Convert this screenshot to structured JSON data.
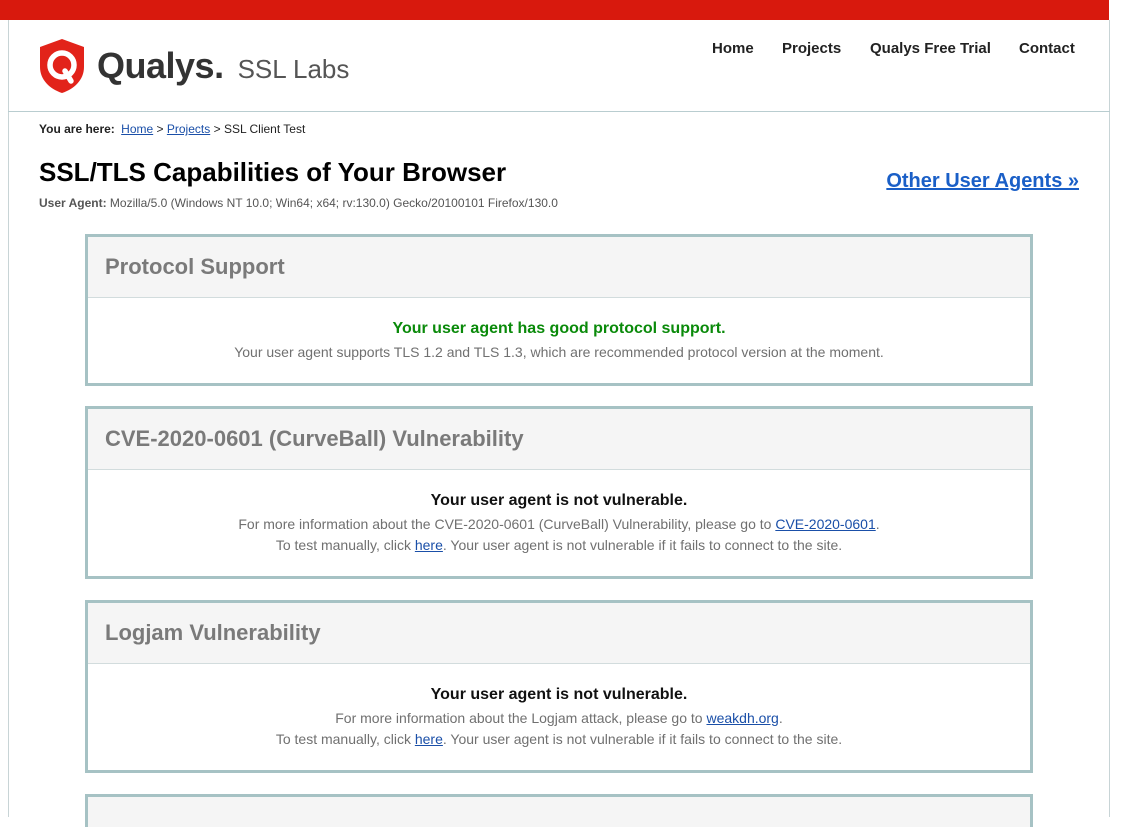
{
  "brand": {
    "name": "Qualys",
    "dot": ".",
    "product": "SSL Labs",
    "shield_color": "#e2231a"
  },
  "nav": {
    "home": "Home",
    "projects": "Projects",
    "trial": "Qualys Free Trial",
    "contact": "Contact"
  },
  "breadcrumb": {
    "prefix": "You are here:",
    "home": "Home",
    "sep1": ">",
    "projects": "Projects",
    "sep2": ">",
    "current": "SSL Client Test"
  },
  "page": {
    "title": "SSL/TLS Capabilities of Your Browser",
    "ua_label": "User Agent:",
    "ua_value": "Mozilla/5.0 (Windows NT 10.0; Win64; x64; rv:130.0) Gecko/20100101 Firefox/130.0",
    "other_ua_link": "Other User Agents »"
  },
  "sections": {
    "protocol": {
      "title": "Protocol Support",
      "verdict": "Your user agent has good protocol support.",
      "detail": "Your user agent supports TLS 1.2 and TLS 1.3, which are recommended protocol version at the moment."
    },
    "curveball": {
      "title": "CVE-2020-0601 (CurveBall) Vulnerability",
      "verdict": "Your user agent is not vulnerable.",
      "info_prefix": "For more information about the CVE-2020-0601 (CurveBall) Vulnerability, please go to",
      "info_link": "CVE-2020-0601",
      "info_suffix": ".",
      "test_prefix": "To test manually, click",
      "test_link": "here",
      "test_suffix": ". Your user agent is not vulnerable if it fails to connect to the site."
    },
    "logjam": {
      "title": "Logjam Vulnerability",
      "verdict": "Your user agent is not vulnerable.",
      "info_prefix": "For more information about the Logjam attack, please go to",
      "info_link": "weakdh.org",
      "info_suffix": ".",
      "test_prefix": "To test manually, click",
      "test_link": "here",
      "test_suffix": ". Your user agent is not vulnerable if it fails to connect to the site."
    }
  },
  "colors": {
    "topbar": "#d8190d",
    "box_border": "#a6c2c4",
    "good": "#0a8a0a",
    "link": "#1a4fa8"
  }
}
